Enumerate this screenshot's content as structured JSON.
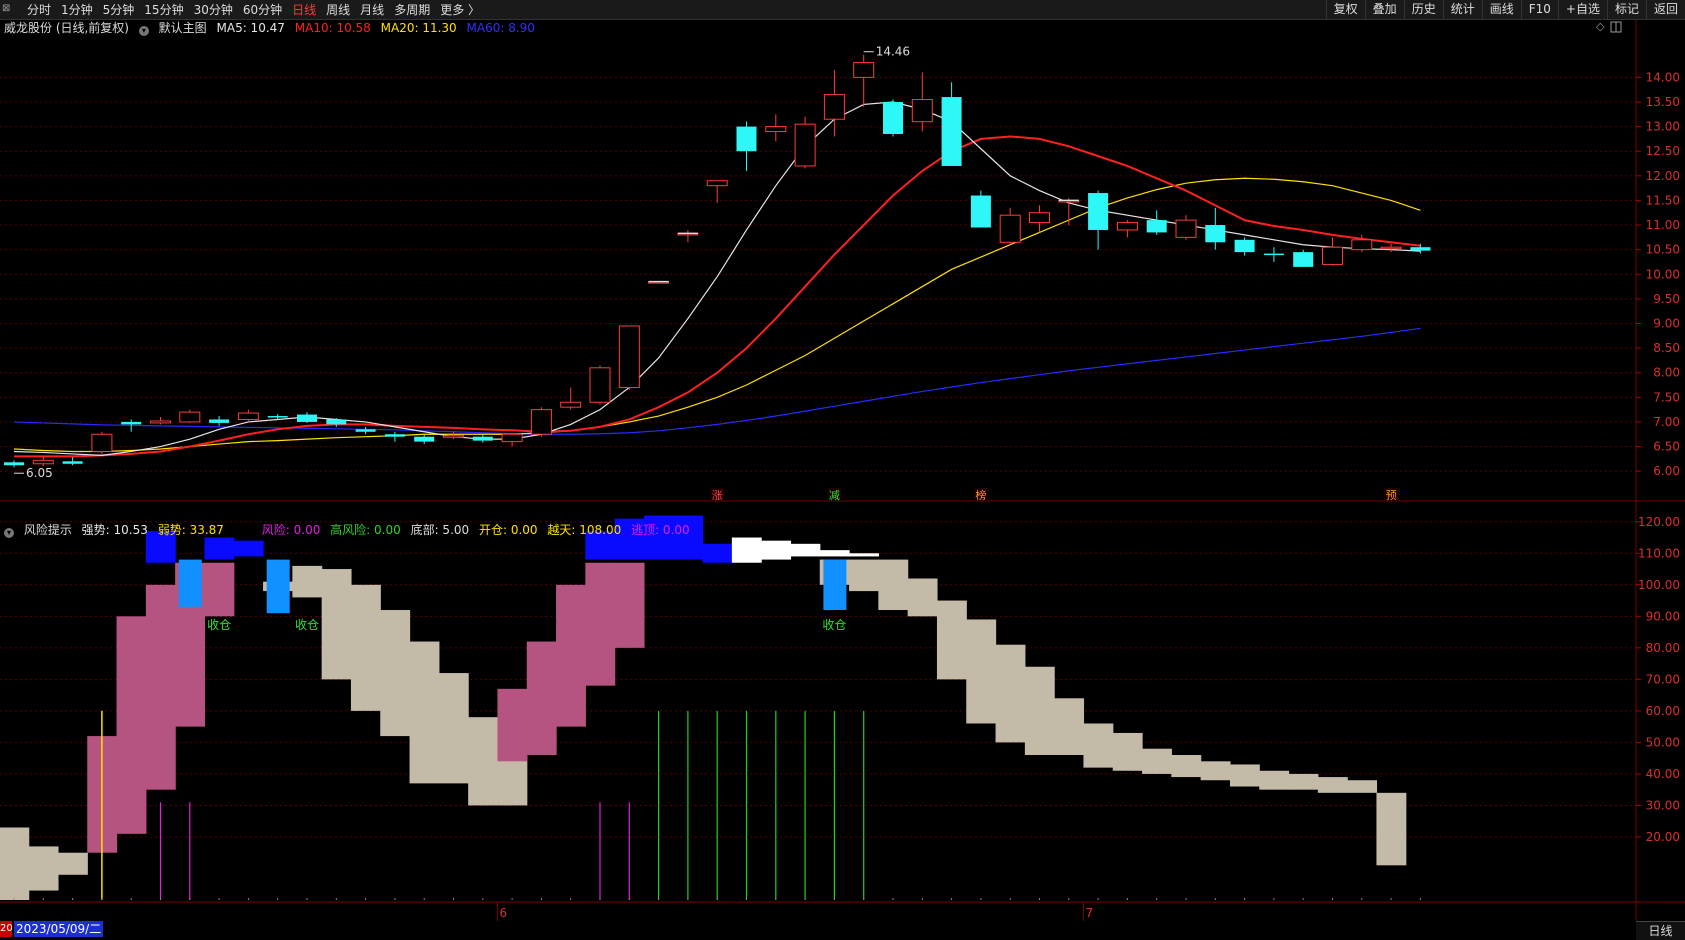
{
  "toolbar": {
    "corner_glyph": "⊠",
    "periods": [
      "分时",
      "1分钟",
      "5分钟",
      "15分钟",
      "30分钟",
      "60分钟",
      "日线",
      "周线",
      "月线",
      "多周期",
      "更多 〉"
    ],
    "active_period": "日线",
    "tools": [
      "复权",
      "叠加",
      "历史",
      "统计",
      "画线",
      "F10",
      "+自选",
      "标记",
      "返回"
    ]
  },
  "main_header": {
    "stock": "威龙股份 (日线,前复权)",
    "template": "默认主图",
    "ma5": "MA5: 10.47",
    "ma10": "MA10: 10.58",
    "ma20": "MA20: 11.30",
    "ma60": "MA60: 8.90"
  },
  "indicator_header": {
    "name": "风险提示",
    "strong": "强势: 10.53",
    "weak": "弱势: 33.87",
    "risk": "风险: 0.00",
    "high_risk": "高风险: 0.00",
    "bottom": "底部: 5.00",
    "open_pos": "开仓: 0.00",
    "sky": "越天: 108.00",
    "escape": "逃顶: 0.00"
  },
  "colors": {
    "up": "#ff3b3b",
    "down": "#2ef7f7",
    "ma5": "#e6e6e6",
    "ma10": "#ff2020",
    "ma20": "#ffe000",
    "ma60": "#2a2aff",
    "pink": "#b55481",
    "beige": "#c3bba8",
    "blue": "#0a0aff",
    "lightblue": "#1190ff",
    "white": "#ffffff",
    "green_line": "#20d020",
    "magenta_line": "#e020e0",
    "yellow_line": "#ffe000",
    "grid": "#5a0000",
    "axis_text": "#d83030"
  },
  "chart_data": [
    {
      "type": "candlestick",
      "title": "",
      "ylim": [
        5.8,
        14.8
      ],
      "y_ticks": [
        6.0,
        6.5,
        7.0,
        7.5,
        8.0,
        8.5,
        9.0,
        9.5,
        10.0,
        10.5,
        11.0,
        11.5,
        12.0,
        12.5,
        13.0,
        13.5,
        14.0
      ],
      "candles": [
        {
          "o": 6.18,
          "h": 6.22,
          "l": 6.08,
          "c": 6.12
        },
        {
          "o": 6.15,
          "h": 6.3,
          "l": 6.1,
          "c": 6.22
        },
        {
          "o": 6.2,
          "h": 6.28,
          "l": 6.12,
          "c": 6.15
        },
        {
          "o": 6.4,
          "h": 6.8,
          "l": 6.35,
          "c": 6.75
        },
        {
          "o": 7.0,
          "h": 7.05,
          "l": 6.8,
          "c": 6.95
        },
        {
          "o": 6.98,
          "h": 7.1,
          "l": 6.95,
          "c": 7.02
        },
        {
          "o": 7.0,
          "h": 7.25,
          "l": 6.98,
          "c": 7.2
        },
        {
          "o": 7.05,
          "h": 7.12,
          "l": 6.92,
          "c": 6.98
        },
        {
          "o": 7.05,
          "h": 7.25,
          "l": 7.0,
          "c": 7.18
        },
        {
          "o": 7.12,
          "h": 7.16,
          "l": 7.05,
          "c": 7.1
        },
        {
          "o": 7.15,
          "h": 7.2,
          "l": 6.98,
          "c": 7.0
        },
        {
          "o": 7.05,
          "h": 7.08,
          "l": 6.9,
          "c": 6.95
        },
        {
          "o": 6.85,
          "h": 6.9,
          "l": 6.75,
          "c": 6.8
        },
        {
          "o": 6.75,
          "h": 6.8,
          "l": 6.6,
          "c": 6.7
        },
        {
          "o": 6.7,
          "h": 6.75,
          "l": 6.55,
          "c": 6.6
        },
        {
          "o": 6.7,
          "h": 6.8,
          "l": 6.65,
          "c": 6.72
        },
        {
          "o": 6.7,
          "h": 6.75,
          "l": 6.58,
          "c": 6.62
        },
        {
          "o": 6.6,
          "h": 6.78,
          "l": 6.5,
          "c": 6.75
        },
        {
          "o": 6.75,
          "h": 7.3,
          "l": 6.7,
          "c": 7.25
        },
        {
          "o": 7.3,
          "h": 7.7,
          "l": 7.25,
          "c": 7.4
        },
        {
          "o": 7.4,
          "h": 8.15,
          "l": 7.35,
          "c": 8.1
        },
        {
          "o": 7.7,
          "h": 8.95,
          "l": 7.65,
          "c": 8.95
        },
        {
          "o": 9.85,
          "h": 9.85,
          "l": 9.85,
          "c": 9.85
        },
        {
          "o": 10.83,
          "h": 10.9,
          "l": 10.65,
          "c": 10.83
        },
        {
          "o": 11.8,
          "h": 11.9,
          "l": 11.45,
          "c": 11.9
        },
        {
          "o": 13.0,
          "h": 13.1,
          "l": 12.1,
          "c": 12.5
        },
        {
          "o": 12.9,
          "h": 13.25,
          "l": 12.7,
          "c": 13.0
        },
        {
          "o": 12.2,
          "h": 13.2,
          "l": 12.15,
          "c": 13.05
        },
        {
          "o": 13.15,
          "h": 14.15,
          "l": 12.8,
          "c": 13.65
        },
        {
          "o": 14.0,
          "h": 14.46,
          "l": 13.4,
          "c": 14.3
        },
        {
          "o": 13.5,
          "h": 13.55,
          "l": 12.8,
          "c": 12.85
        },
        {
          "o": 13.1,
          "h": 14.1,
          "l": 12.9,
          "c": 13.55
        },
        {
          "o": 13.6,
          "h": 13.9,
          "l": 12.2,
          "c": 12.2
        },
        {
          "o": 11.6,
          "h": 11.7,
          "l": 10.95,
          "c": 10.95
        },
        {
          "o": 10.65,
          "h": 11.35,
          "l": 10.6,
          "c": 11.2
        },
        {
          "o": 11.05,
          "h": 11.4,
          "l": 10.85,
          "c": 11.25
        },
        {
          "o": 11.5,
          "h": 11.55,
          "l": 11.0,
          "c": 11.5
        },
        {
          "o": 11.65,
          "h": 11.7,
          "l": 10.5,
          "c": 10.9
        },
        {
          "o": 10.9,
          "h": 11.1,
          "l": 10.75,
          "c": 11.05
        },
        {
          "o": 11.1,
          "h": 11.3,
          "l": 10.8,
          "c": 10.85
        },
        {
          "o": 10.75,
          "h": 11.2,
          "l": 10.7,
          "c": 11.1
        },
        {
          "o": 11.0,
          "h": 11.35,
          "l": 10.5,
          "c": 10.65
        },
        {
          "o": 10.7,
          "h": 10.75,
          "l": 10.38,
          "c": 10.45
        },
        {
          "o": 10.42,
          "h": 10.55,
          "l": 10.25,
          "c": 10.4
        },
        {
          "o": 10.45,
          "h": 10.5,
          "l": 10.15,
          "c": 10.15
        },
        {
          "o": 10.2,
          "h": 10.75,
          "l": 10.18,
          "c": 10.55
        },
        {
          "o": 10.5,
          "h": 10.8,
          "l": 10.45,
          "c": 10.7
        },
        {
          "o": 10.52,
          "h": 10.62,
          "l": 10.45,
          "c": 10.55
        },
        {
          "o": 10.55,
          "h": 10.62,
          "l": 10.42,
          "c": 10.48
        }
      ],
      "ma5": [
        6.4,
        6.38,
        6.35,
        6.32,
        6.4,
        6.5,
        6.65,
        6.85,
        7.0,
        7.05,
        7.1,
        7.05,
        7.0,
        6.9,
        6.8,
        6.7,
        6.65,
        6.65,
        6.75,
        6.95,
        7.25,
        7.7,
        8.3,
        9.1,
        9.95,
        10.9,
        11.8,
        12.6,
        13.15,
        13.45,
        13.5,
        13.35,
        13.1,
        12.55,
        12.0,
        11.7,
        11.45,
        11.3,
        11.2,
        11.1,
        11.0,
        10.9,
        10.8,
        10.7,
        10.6,
        10.55,
        10.52,
        10.5,
        10.47
      ],
      "ma10": [
        6.3,
        6.3,
        6.3,
        6.32,
        6.35,
        6.4,
        6.5,
        6.62,
        6.75,
        6.85,
        6.92,
        6.95,
        6.95,
        6.92,
        6.9,
        6.88,
        6.85,
        6.83,
        6.8,
        6.82,
        6.9,
        7.05,
        7.3,
        7.6,
        8.0,
        8.5,
        9.1,
        9.75,
        10.4,
        11.0,
        11.6,
        12.1,
        12.5,
        12.75,
        12.8,
        12.75,
        12.6,
        12.4,
        12.2,
        11.95,
        11.7,
        11.4,
        11.1,
        10.98,
        10.9,
        10.8,
        10.72,
        10.65,
        10.58
      ],
      "ma20": [
        6.45,
        6.42,
        6.4,
        6.4,
        6.42,
        6.45,
        6.5,
        6.55,
        6.6,
        6.62,
        6.65,
        6.68,
        6.7,
        6.72,
        6.75,
        6.75,
        6.75,
        6.75,
        6.78,
        6.82,
        6.9,
        7.0,
        7.12,
        7.3,
        7.5,
        7.75,
        8.05,
        8.35,
        8.7,
        9.05,
        9.4,
        9.75,
        10.1,
        10.35,
        10.6,
        10.85,
        11.1,
        11.35,
        11.55,
        11.72,
        11.85,
        11.92,
        11.95,
        11.93,
        11.88,
        11.8,
        11.65,
        11.5,
        11.3
      ],
      "ma60": [
        7.0,
        6.98,
        6.96,
        6.94,
        6.93,
        6.92,
        6.91,
        6.9,
        6.89,
        6.88,
        6.87,
        6.86,
        6.85,
        6.84,
        6.82,
        6.8,
        6.78,
        6.76,
        6.75,
        6.75,
        6.76,
        6.78,
        6.82,
        6.88,
        6.95,
        7.03,
        7.12,
        7.22,
        7.32,
        7.42,
        7.52,
        7.62,
        7.71,
        7.8,
        7.88,
        7.96,
        8.04,
        8.11,
        8.18,
        8.25,
        8.32,
        8.39,
        8.46,
        8.53,
        8.6,
        8.67,
        8.74,
        8.82,
        8.9
      ],
      "annotations": [
        {
          "index": 29,
          "text": "14.46",
          "kind": "high"
        },
        {
          "index": 0,
          "text": "6.05",
          "kind": "low"
        }
      ],
      "markers": [
        {
          "index": 24,
          "text": "涨",
          "color": "#ff4040"
        },
        {
          "index": 28,
          "text": "减",
          "color": "#30e030"
        },
        {
          "index": 33,
          "text": "榜",
          "color": "#ff9020"
        },
        {
          "index": 47,
          "text": "预",
          "color": "#ff9020"
        }
      ]
    },
    {
      "type": "bar",
      "title": "",
      "ylim": [
        0,
        125
      ],
      "y_ticks": [
        20,
        30,
        40,
        50,
        60,
        70,
        80,
        90,
        100,
        110,
        120
      ],
      "beige": [
        [
          0,
          23
        ],
        [
          3,
          17
        ],
        [
          8,
          15
        ],
        null,
        null,
        null,
        null,
        null,
        null,
        [
          98,
          101
        ],
        [
          96,
          106
        ],
        [
          70,
          105
        ],
        [
          60,
          100
        ],
        [
          52,
          92
        ],
        [
          37,
          82
        ],
        [
          37,
          72
        ],
        [
          30,
          58
        ],
        [
          30,
          48
        ],
        null,
        null,
        null,
        null,
        null,
        null,
        null,
        null,
        null,
        null,
        [
          100,
          108
        ],
        [
          98,
          108
        ],
        [
          92,
          108
        ],
        [
          90,
          102
        ],
        [
          70,
          95
        ],
        [
          56,
          89
        ],
        [
          50,
          81
        ],
        [
          46,
          74
        ],
        [
          46,
          64
        ],
        [
          42,
          56
        ],
        [
          41,
          53
        ],
        [
          40,
          48
        ],
        [
          39,
          46
        ],
        [
          38,
          44
        ],
        [
          36,
          43
        ],
        [
          35,
          41
        ],
        [
          35,
          40
        ],
        [
          34,
          39
        ],
        [
          34,
          38
        ],
        [
          11,
          34
        ]
      ],
      "pink": [
        null,
        null,
        null,
        [
          15,
          52
        ],
        [
          21,
          90
        ],
        [
          35,
          100
        ],
        [
          55,
          107
        ],
        [
          90,
          107
        ],
        null,
        null,
        null,
        null,
        null,
        null,
        null,
        null,
        null,
        [
          44,
          67
        ],
        [
          46,
          82
        ],
        [
          55,
          100
        ],
        [
          68,
          107
        ],
        [
          80,
          107
        ],
        null,
        null,
        null,
        null,
        null,
        null,
        null,
        null,
        null,
        null,
        null,
        null,
        null,
        null,
        null,
        null,
        null,
        null,
        null,
        null,
        null,
        null,
        null,
        null,
        null,
        null,
        null
      ],
      "blue": [
        null,
        null,
        null,
        null,
        null,
        [
          107,
          117
        ],
        null,
        [
          108,
          115
        ],
        [
          109,
          114
        ],
        null,
        null,
        null,
        null,
        null,
        null,
        null,
        null,
        null,
        null,
        null,
        [
          108,
          117
        ],
        [
          108,
          121
        ],
        [
          108,
          122
        ],
        [
          108,
          122
        ],
        [
          107,
          113
        ],
        null,
        null,
        null,
        null,
        null,
        null,
        null,
        null,
        null,
        null,
        null,
        null,
        null,
        null,
        null,
        null,
        null,
        null,
        null,
        null,
        null,
        null,
        null,
        null
      ],
      "white": [
        null,
        null,
        null,
        null,
        null,
        null,
        null,
        null,
        null,
        null,
        null,
        null,
        null,
        null,
        null,
        null,
        null,
        null,
        null,
        null,
        null,
        null,
        null,
        null,
        null,
        [
          107,
          115
        ],
        [
          108,
          114
        ],
        [
          109,
          113
        ],
        [
          109,
          111
        ],
        [
          109,
          110
        ],
        null,
        null,
        null,
        null,
        null,
        null,
        null,
        null,
        null,
        null,
        null,
        null,
        null,
        null,
        null,
        null,
        null,
        null,
        null
      ],
      "lightblue": [
        null,
        null,
        null,
        null,
        null,
        null,
        [
          93,
          108
        ],
        null,
        null,
        [
          91,
          108
        ],
        null,
        null,
        null,
        null,
        null,
        null,
        null,
        null,
        null,
        null,
        null,
        null,
        null,
        null,
        null,
        null,
        null,
        null,
        [
          92,
          108
        ],
        null,
        null,
        null,
        null,
        null,
        null,
        null,
        null,
        null,
        null,
        null,
        null,
        null,
        null,
        null,
        null,
        null,
        null,
        null,
        null
      ],
      "labels": [
        {
          "index": 7,
          "text": "收仓"
        },
        {
          "index": 10,
          "text": "收仓"
        },
        {
          "index": 28,
          "text": "收仓"
        }
      ],
      "green_sticks": [
        22,
        23,
        24,
        25,
        26,
        27,
        28,
        29
      ],
      "magenta_sticks": [
        5,
        6,
        20,
        21
      ],
      "yellow_sticks": [
        3
      ],
      "x_labels": [
        {
          "index": 0,
          "text": "2023/05/09/二"
        },
        {
          "index": 17,
          "text": "6"
        },
        {
          "index": 37,
          "text": "7"
        }
      ]
    }
  ],
  "footer": {
    "date": "2023/05/09/二",
    "date_edge": "20",
    "period": "日线"
  }
}
